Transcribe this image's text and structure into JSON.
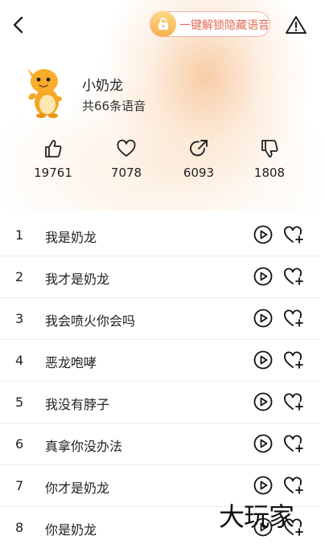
{
  "header": {
    "unlock_label": "一键解锁隐藏语音"
  },
  "pack": {
    "name": "小奶龙",
    "count_text": "共66条语音"
  },
  "stats": [
    {
      "icon": "thumbs-up-icon",
      "value": "19761"
    },
    {
      "icon": "heart-icon",
      "value": "7078"
    },
    {
      "icon": "share-icon",
      "value": "6093"
    },
    {
      "icon": "thumbs-down-icon",
      "value": "1808"
    }
  ],
  "voices": [
    {
      "num": "1",
      "title": "我是奶龙"
    },
    {
      "num": "2",
      "title": "我才是奶龙"
    },
    {
      "num": "3",
      "title": "我会喷火你会吗"
    },
    {
      "num": "4",
      "title": "恶龙咆哮"
    },
    {
      "num": "5",
      "title": "我没有脖子"
    },
    {
      "num": "6",
      "title": "真拿你没办法"
    },
    {
      "num": "7",
      "title": "你才是奶龙"
    },
    {
      "num": "8",
      "title": "你是奶龙"
    }
  ],
  "watermark": "大玩家",
  "colors": {
    "accent_text": "#e46a55",
    "pill_border": "#f6b6a6",
    "lock_badge": "#f4b14b",
    "mascot": "#f5a623"
  }
}
